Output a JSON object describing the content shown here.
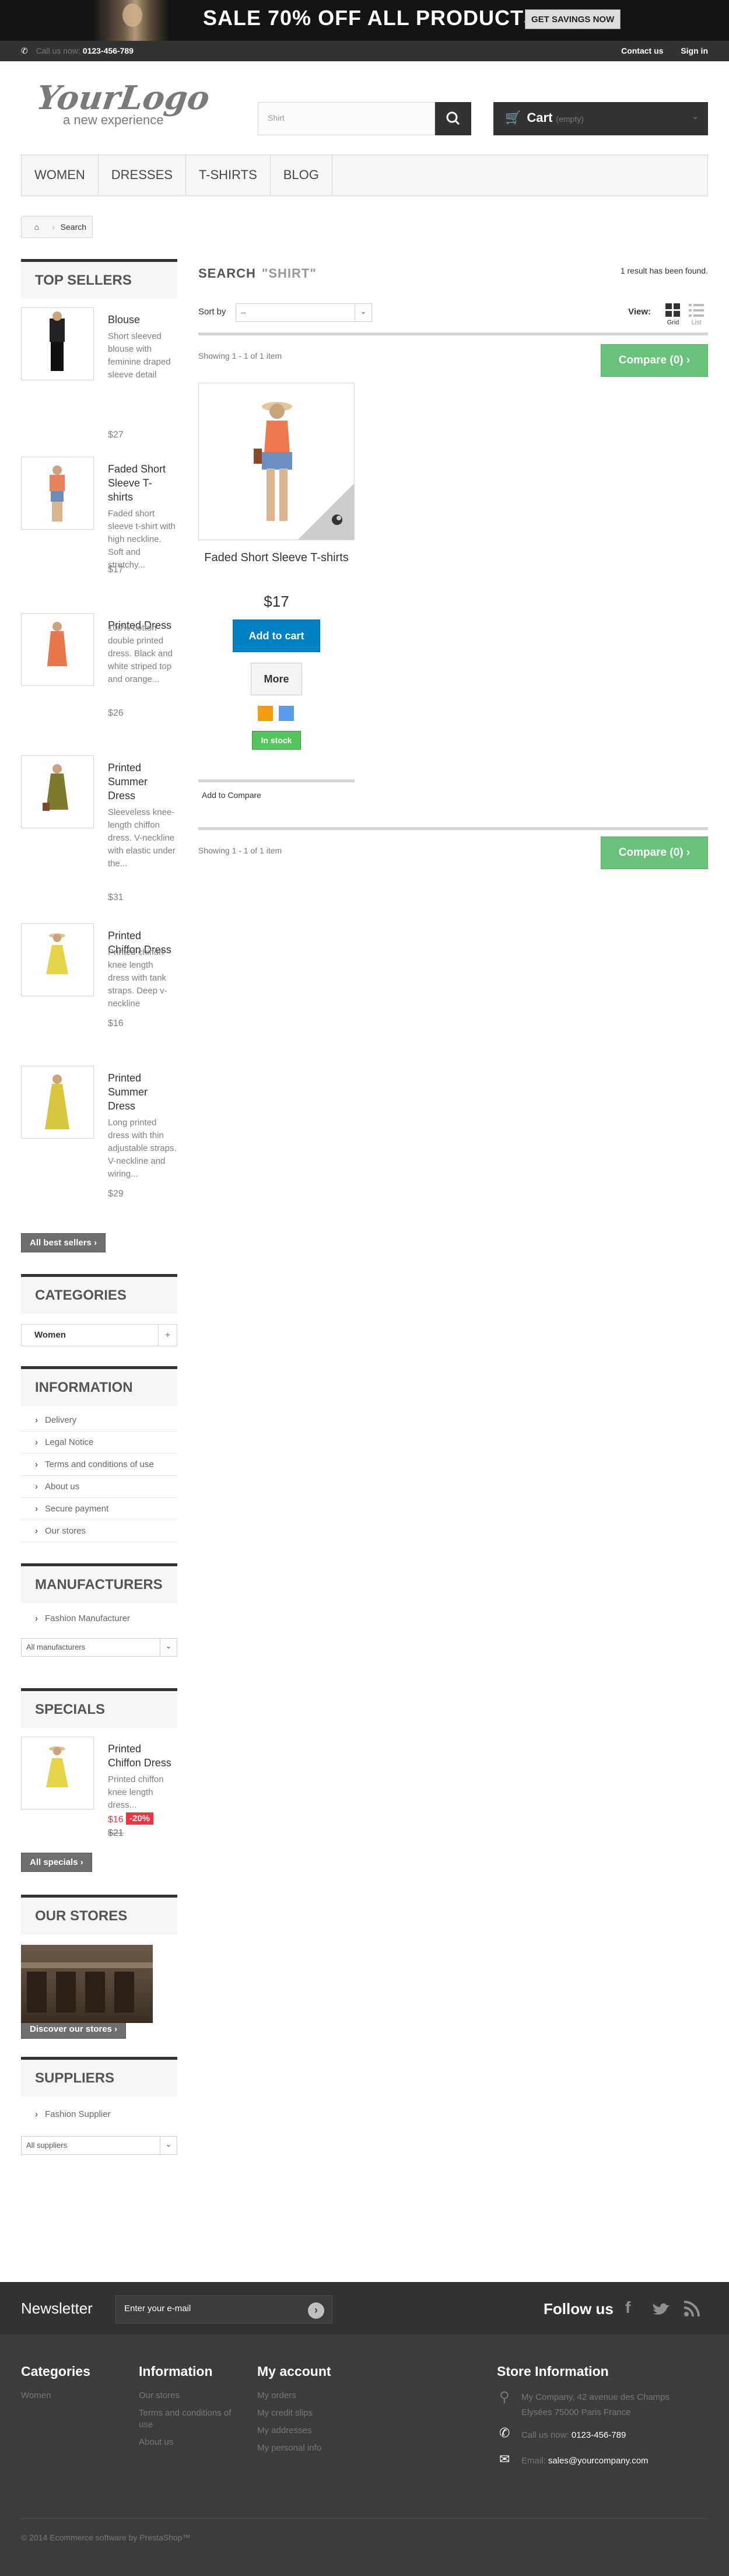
{
  "banner": {
    "sale_text": "SALE 70% OFF ALL PRODUCTS",
    "button": "GET SAVINGS NOW"
  },
  "topbar": {
    "call_label": "Call us now:",
    "phone": "0123-456-789",
    "contact": "Contact us",
    "signin": "Sign in"
  },
  "logo": {
    "name": "YourLogo",
    "tagline": "a new experience"
  },
  "search": {
    "value": "Shirt"
  },
  "cart": {
    "label": "Cart",
    "status": "(empty)"
  },
  "menu": [
    "WOMEN",
    "DRESSES",
    "T-SHIRTS",
    "BLOG"
  ],
  "breadcrumb": {
    "current": "Search"
  },
  "sidebar": {
    "top_sellers": {
      "title": "TOP SELLERS",
      "items": [
        {
          "name": "Blouse",
          "desc": "Short sleeved blouse with feminine draped sleeve detail",
          "price": "$27"
        },
        {
          "name": "Faded Short Sleeve T-shirts",
          "desc": "Faded short sleeve t-shirt with high neckline. Soft and stretchy...",
          "price": "$17"
        },
        {
          "name": "Printed Dress",
          "desc": "100% cotton double printed dress. Black and white striped top and orange...",
          "price": "$26"
        },
        {
          "name": "Printed Summer Dress",
          "desc": "Sleeveless knee-length chiffon dress. V-neckline with elastic under the...",
          "price": "$31"
        },
        {
          "name": "Printed Chiffon Dress",
          "desc": "Printed chiffon knee length dress with tank straps. Deep v-neckline",
          "price": "$16"
        },
        {
          "name": "Printed Summer Dress",
          "desc": "Long printed dress with thin adjustable straps. V-neckline and wiring...",
          "price": "$29"
        }
      ],
      "all_button": "All best sellers"
    },
    "categories": {
      "title": "CATEGORIES",
      "items": [
        "Women"
      ]
    },
    "information": {
      "title": "INFORMATION",
      "items": [
        "Delivery",
        "Legal Notice",
        "Terms and conditions of use",
        "About us",
        "Secure payment",
        "Our stores"
      ]
    },
    "manufacturers": {
      "title": "MANUFACTURERS",
      "items": [
        "Fashion Manufacturer"
      ],
      "select": "All manufacturers"
    },
    "specials": {
      "title": "SPECIALS",
      "name": "Printed Chiffon Dress",
      "desc": "Printed chiffon knee length dress...",
      "price": "$16",
      "discount": "-20%",
      "old_price": "$21",
      "all_button": "All specials"
    },
    "stores": {
      "title": "OUR STORES",
      "button": "Discover our stores"
    },
    "suppliers": {
      "title": "SUPPLIERS",
      "items": [
        "Fashion Supplier"
      ],
      "select": "All suppliers"
    }
  },
  "main": {
    "title": "SEARCH",
    "query": "\"SHIRT\"",
    "found": "1 result has been found.",
    "sort_label": "Sort by",
    "sort_value": "--",
    "view_label": "View:",
    "grid_label": "Grid",
    "list_label": "List",
    "showing": "Showing 1 - 1 of 1 item",
    "compare": "Compare (0)",
    "product": {
      "name": "Faded Short Sleeve T-shirts",
      "price": "$17",
      "add_to_cart": "Add to cart",
      "more": "More",
      "stock": "In stock",
      "add_compare": "Add to Compare",
      "colors": [
        "#f39c11",
        "#5d9cec"
      ]
    }
  },
  "newsletter": {
    "label": "Newsletter",
    "placeholder": "Enter your e-mail",
    "follow": "Follow us"
  },
  "footer": {
    "categories": {
      "title": "Categories",
      "items": [
        "Women"
      ]
    },
    "information": {
      "title": "Information",
      "items": [
        "Our stores",
        "Terms and conditions of use",
        "About us"
      ]
    },
    "account": {
      "title": "My account",
      "items": [
        "My orders",
        "My credit slips",
        "My addresses",
        "My personal info"
      ]
    },
    "store": {
      "title": "Store Information",
      "address": "My Company, 42 avenue des Champs Elysées 75000 Paris France",
      "call_label": "Call us now:",
      "phone": "0123-456-789",
      "email_label": "Email:",
      "email": "sales@yourcompany.com"
    },
    "copyright": "© 2014 Ecommerce software by PrestaShop™"
  }
}
